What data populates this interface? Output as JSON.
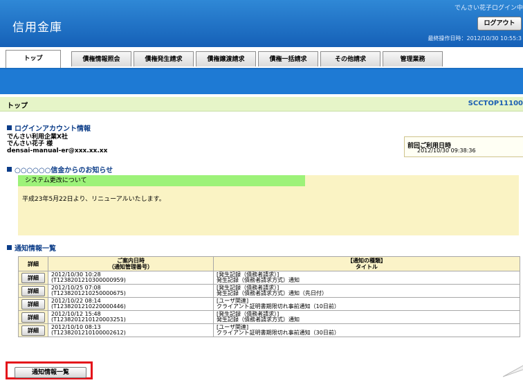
{
  "header": {
    "bank_name": "信用金庫",
    "login_user": "でんさい花子ログイン中",
    "logout_label": "ログアウト",
    "last_operation": "最終操作日時：2012/10/30 10:55:3"
  },
  "tabs": [
    {
      "label": "トップ"
    },
    {
      "label": "債権情報照会"
    },
    {
      "label": "債権発生請求"
    },
    {
      "label": "債権譲渡請求"
    },
    {
      "label": "債権一括請求"
    },
    {
      "label": "その他請求"
    },
    {
      "label": "管理業務"
    }
  ],
  "page": {
    "title": "トップ",
    "screen_code": "SCCTOP11100"
  },
  "login_account": {
    "heading": "ログインアカウント情報",
    "company": "でんさい利用企業X社",
    "user": "でんさい花子 様",
    "email": "densai-manual-er@xxx.xx.xx",
    "prev_label": "前回ご利用日時",
    "prev_value": "2012/10/30 09:38:36"
  },
  "notice": {
    "heading": "○○○○○○信金からのお知らせ",
    "subject": "システム更改について",
    "body": "平成23年5月22日より、リニューアルいたします。"
  },
  "notifications": {
    "heading": "通知情報一覧",
    "col_detail": "詳細",
    "col_date_1": "ご案内日時",
    "col_date_2": "（通知管理番号）",
    "col_type_1": "【通知の種類】",
    "col_type_2": "タイトル",
    "detail_label": "詳細",
    "rows": [
      {
        "date": "2012/10/30 10:28",
        "id": "(T1238201210300000959)",
        "type": "[発生記録（債務者請求）]",
        "title": "発生記録（債務者請求方式）通知"
      },
      {
        "date": "2012/10/25 07:08",
        "id": "(T1238201210250000675)",
        "type": "[発生記録（債務者請求）]",
        "title": "発生記録（債務者請求方式）通知（先日付）"
      },
      {
        "date": "2012/10/22 08:14",
        "id": "(T1238201210220000446)",
        "type": "[ユーザ関連]",
        "title": "クライアント証明書期限切れ事前通知（10日前）"
      },
      {
        "date": "2012/10/12 15:48",
        "id": "(T1238201210120003251)",
        "type": "[発生記録（債務者請求）]",
        "title": "発生記録（債務者請求方式）通知"
      },
      {
        "date": "2012/10/10 08:13",
        "id": "(T1238201210100002612)",
        "type": "[ユーザ関連]",
        "title": "クライアント証明書期限切れ事前通知（30日前）"
      }
    ],
    "list_button": "通知情報一覧"
  }
}
